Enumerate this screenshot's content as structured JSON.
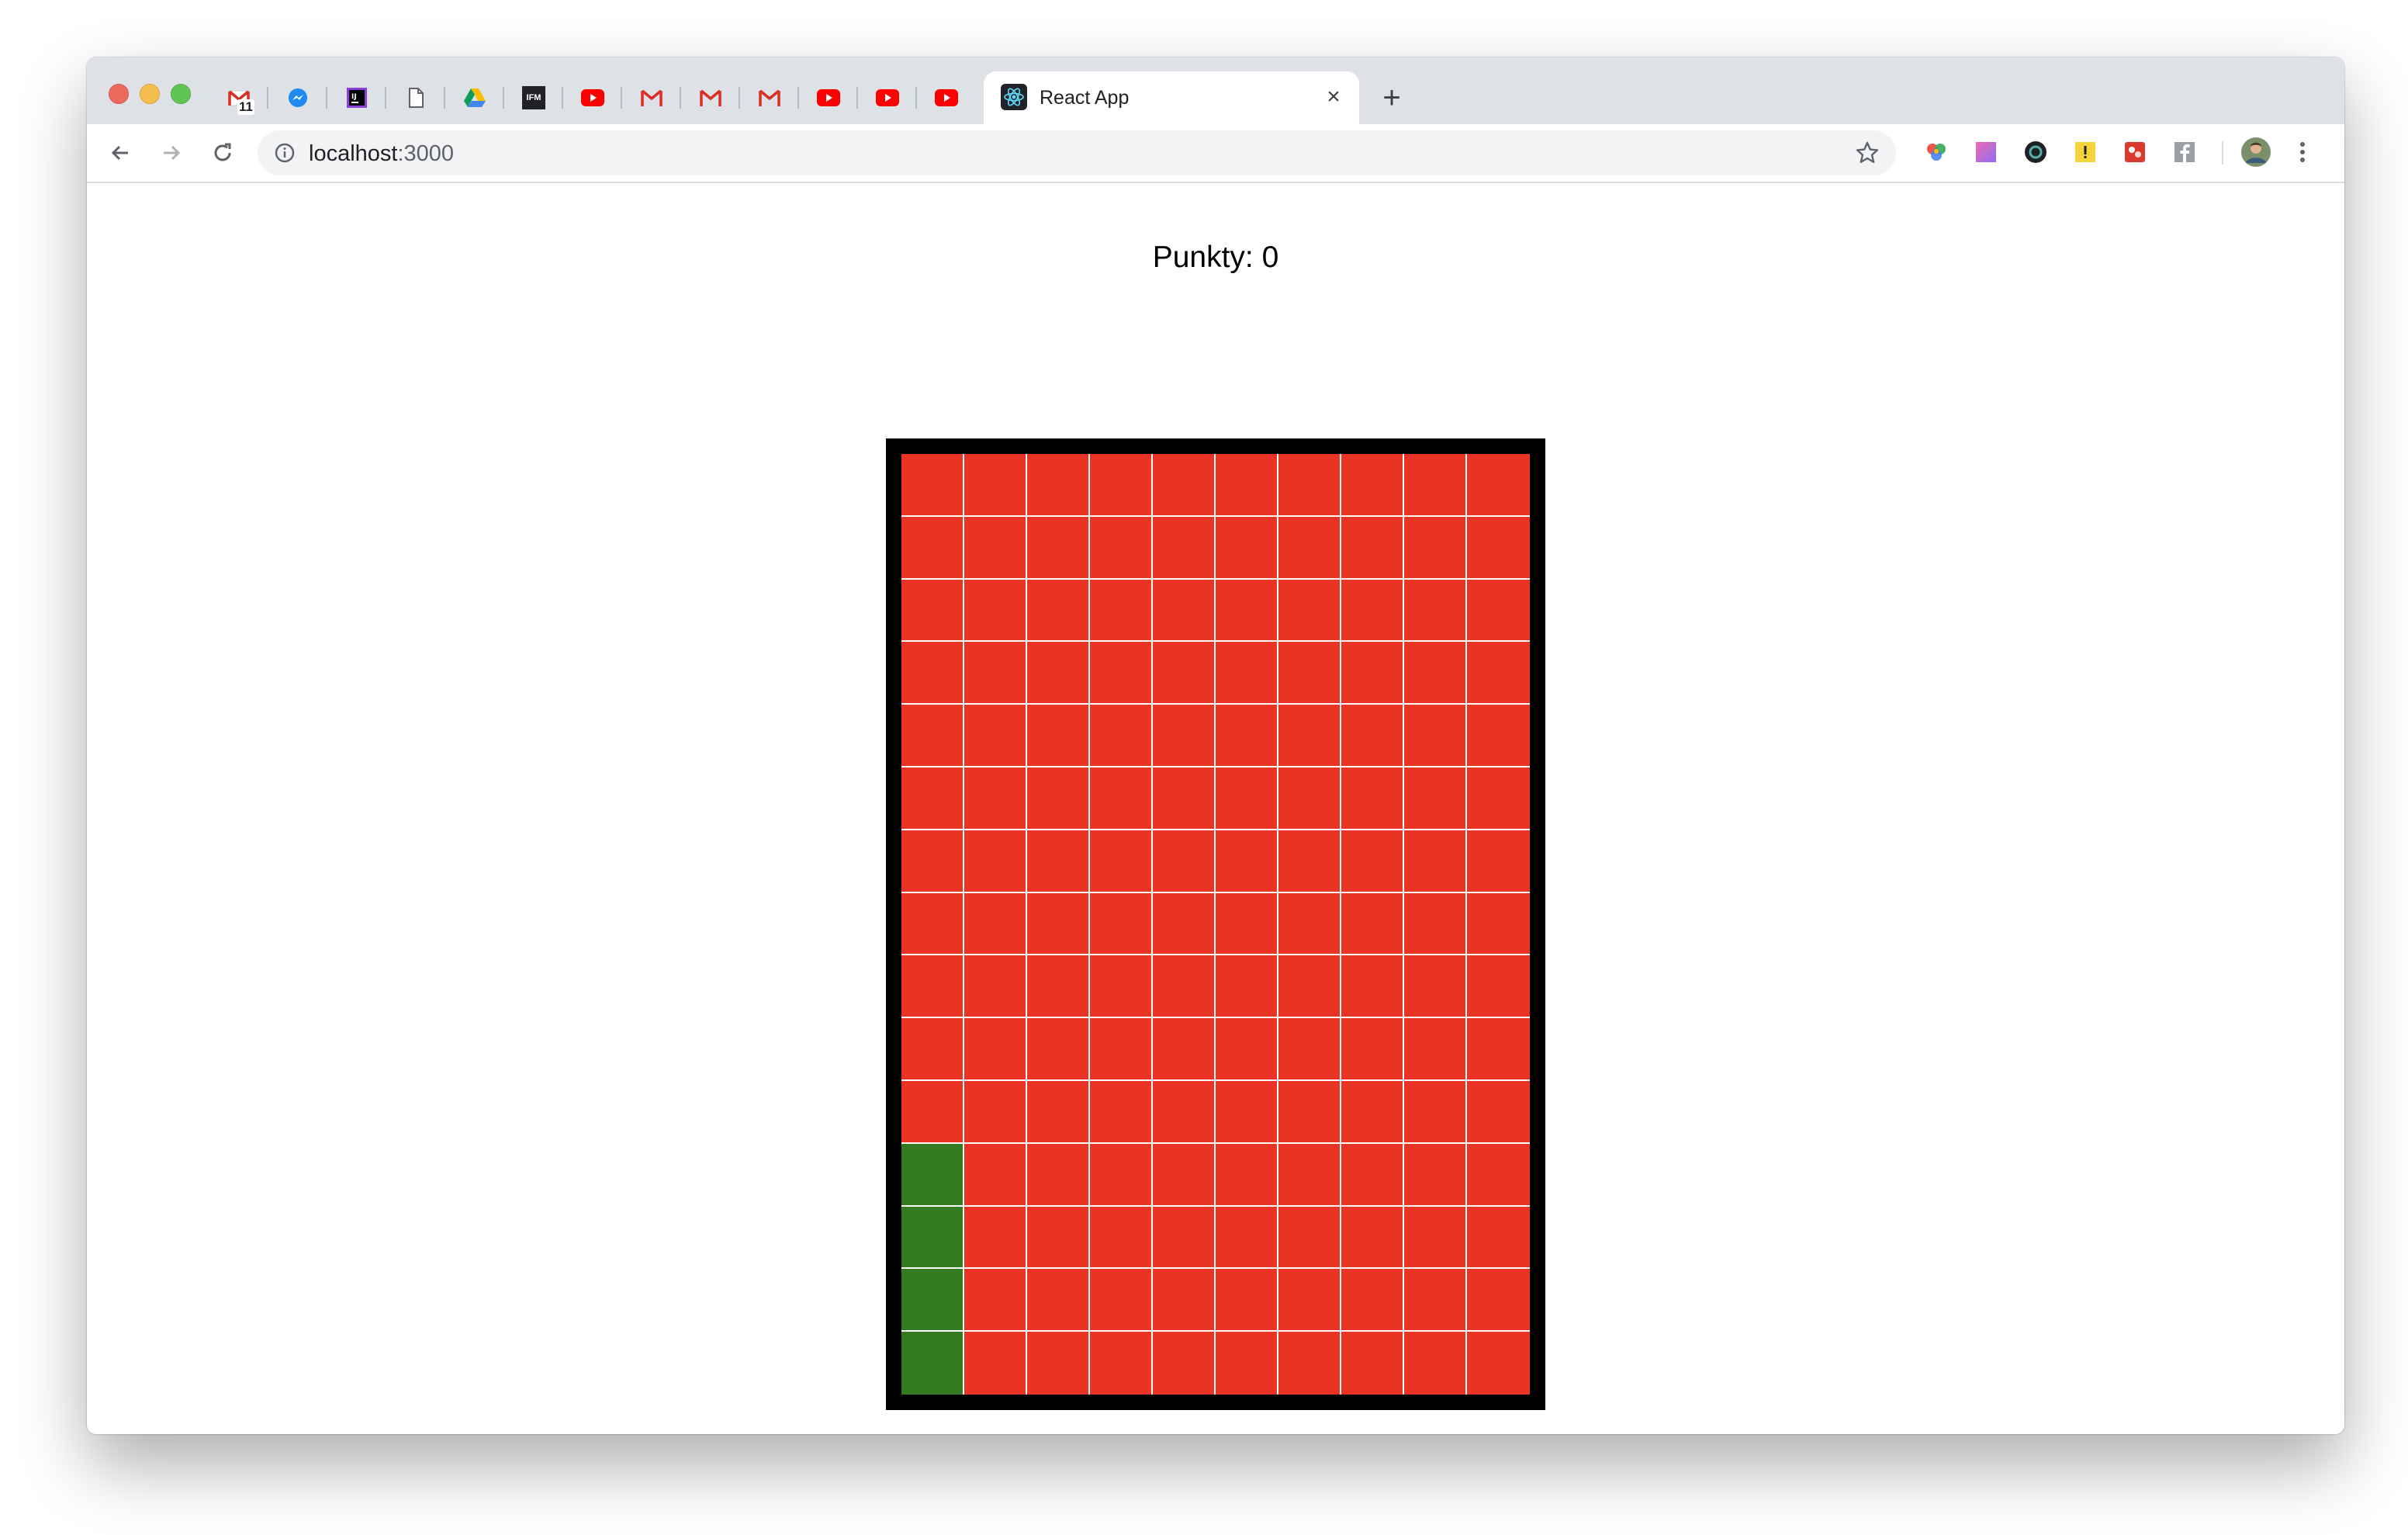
{
  "browser": {
    "pinned_tabs": [
      {
        "name": "gmail-tab",
        "icon": "gmail-icon",
        "badge": "11"
      },
      {
        "name": "messenger-tab",
        "icon": "messenger-icon"
      },
      {
        "name": "intellij-tab",
        "icon": "intellij-icon"
      },
      {
        "name": "document-tab",
        "icon": "document-icon"
      },
      {
        "name": "google-drive-tab",
        "icon": "google-drive-icon"
      },
      {
        "name": "ifm-tab",
        "icon": "ifm-icon",
        "label": "IFM"
      },
      {
        "name": "youtube-tab-1",
        "icon": "youtube-icon"
      },
      {
        "name": "gmail-tab-2",
        "icon": "gmail-icon"
      },
      {
        "name": "gmail-tab-3",
        "icon": "gmail-icon"
      },
      {
        "name": "gmail-tab-4",
        "icon": "gmail-icon"
      },
      {
        "name": "youtube-tab-2",
        "icon": "youtube-icon"
      },
      {
        "name": "youtube-tab-3",
        "icon": "youtube-icon"
      },
      {
        "name": "youtube-tab-4",
        "icon": "youtube-icon"
      }
    ],
    "active_tab": {
      "title": "React App",
      "icon": "react-icon",
      "close_label": "×"
    },
    "new_tab_label": "+",
    "url": {
      "host": "localhost",
      "port": ":3000"
    },
    "extensions": [
      "color-wheel-extension-icon",
      "gradient-extension-icon",
      "dark-circle-extension-icon",
      "yellow-note-extension-icon",
      "red-puzzle-extension-icon",
      "facebook-extension-icon"
    ],
    "profile_icon": "avatar"
  },
  "game": {
    "score_label": "Punkty: 0",
    "grid": {
      "columns": 10,
      "rows": 15,
      "colors": {
        "empty": "#eb3323",
        "filled": "#347a21",
        "border": "#000000",
        "gridline": "#ffffff"
      },
      "filled_cells": [
        [
          11,
          0
        ],
        [
          12,
          0
        ],
        [
          13,
          0
        ],
        [
          14,
          0
        ]
      ]
    }
  }
}
